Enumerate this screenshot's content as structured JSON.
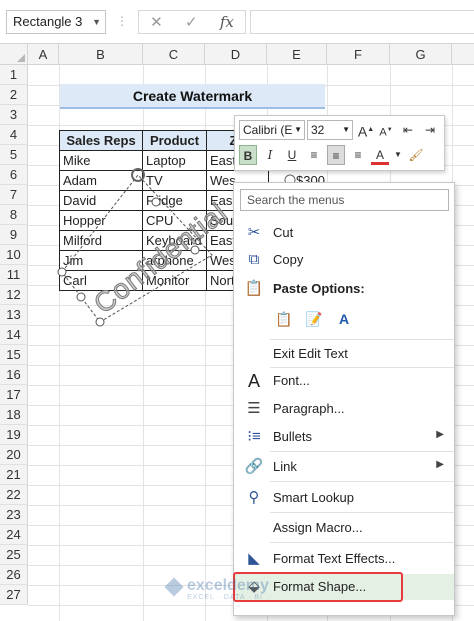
{
  "formula_bar": {
    "name_box": "Rectangle 3",
    "cancel_icon": "✕",
    "enter_icon": "✓",
    "fx_label": "fx",
    "formula_value": ""
  },
  "columns": [
    "A",
    "B",
    "C",
    "D",
    "E",
    "F",
    "G"
  ],
  "rows": [
    "1",
    "2",
    "3",
    "4",
    "5",
    "6",
    "7",
    "8",
    "9",
    "10",
    "11",
    "12",
    "13",
    "14",
    "15",
    "16",
    "17",
    "18",
    "19",
    "20",
    "21",
    "22",
    "23",
    "24",
    "25",
    "26",
    "27"
  ],
  "sheet": {
    "title": "Create Watermark",
    "headers": [
      "Sales Reps",
      "Product",
      "Zo"
    ],
    "reps": [
      "Mike",
      "Adam",
      "David",
      "Hopper",
      "Milford",
      "Jim",
      "Carl"
    ],
    "products": [
      "Laptop",
      "TV",
      "Fridge",
      "CPU",
      "Keyboard",
      "Earphone",
      "Monitor"
    ],
    "zones": [
      "East",
      "West",
      "East",
      "South",
      "East",
      "West",
      "North"
    ],
    "zone_d": [
      "East",
      "Wes",
      "Eas",
      "Sout",
      "East",
      "Wes",
      "Nort"
    ],
    "product_d": [
      "Laptop",
      "TV",
      "Fridge",
      "CPU",
      "Keyboard",
      "arphone",
      "Monitor"
    ],
    "e6_partial": "$300"
  },
  "watermark_text": "Confidential",
  "mini_toolbar": {
    "font_name": "Calibri (E",
    "font_size": "32",
    "grow_font": "A",
    "shrink_font": "A",
    "bold": "B",
    "italic": "I",
    "underline": "U",
    "font_color": "A"
  },
  "context_menu": {
    "search_placeholder": "Search the menus",
    "cut": "Cut",
    "copy": "Copy",
    "paste_options": "Paste Options:",
    "exit_edit_text": "Exit Edit Text",
    "font": "Font...",
    "paragraph": "Paragraph...",
    "bullets": "Bullets",
    "link": "Link",
    "smart_lookup": "Smart Lookup",
    "assign_macro": "Assign Macro...",
    "format_text_effects": "Format Text Effects...",
    "format_shape": "Format Shape..."
  },
  "logo": {
    "main": "exceldemy",
    "sub": "EXCEL · DATA · BI"
  },
  "colors": {
    "title_fill": "#dde9f6",
    "header_fill": "#dde9f6",
    "highlight_box": "#e8393c",
    "font_color_bar": "#e03030"
  }
}
